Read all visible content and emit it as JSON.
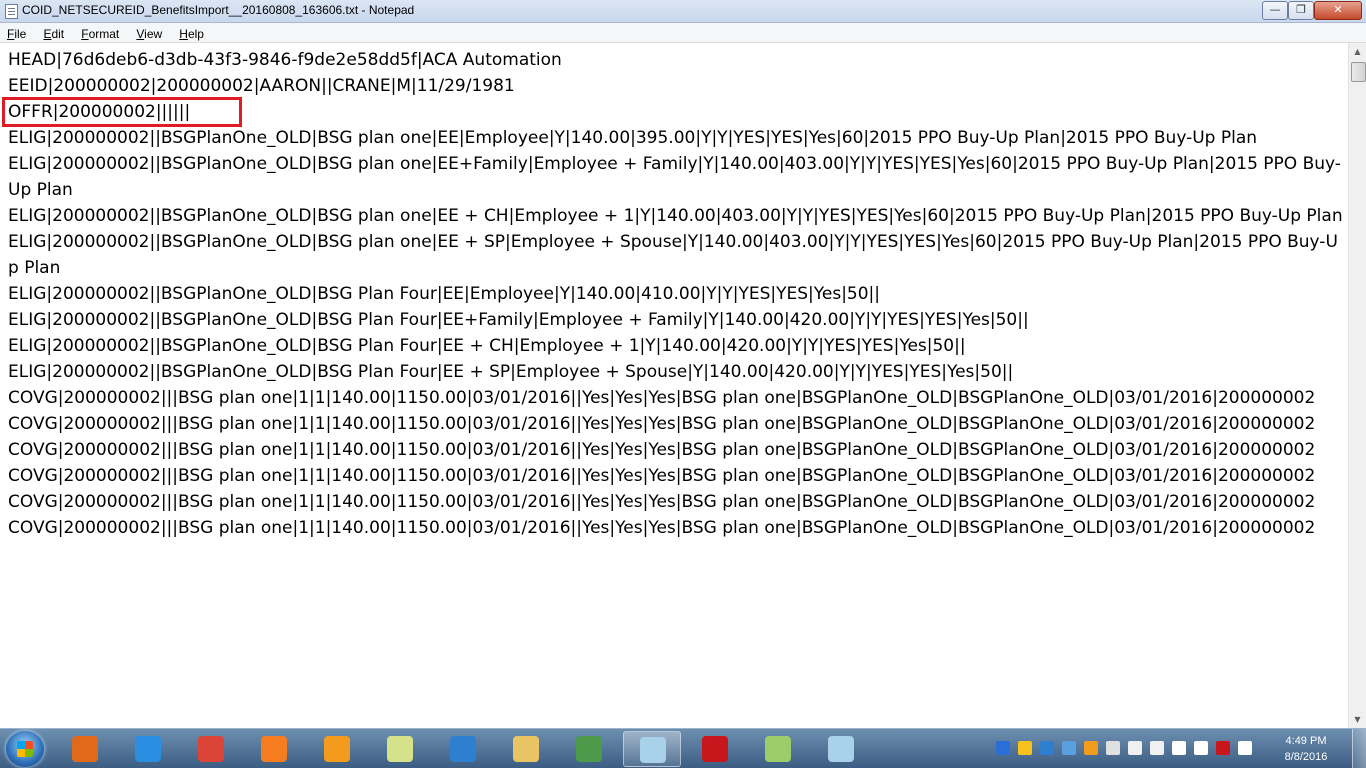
{
  "window": {
    "title": "COID_NETSECUREID_BenefitsImport__20160808_163606.txt - Notepad",
    "minimize_label": "—",
    "maximize_label": "❐",
    "close_label": "✕"
  },
  "menu": {
    "file": "File",
    "edit": "Edit",
    "format": "Format",
    "view": "View",
    "help": "Help"
  },
  "content": {
    "lines": [
      "HEAD|76d6deb6-d3db-43f3-9846-f9de2e58dd5f|ACA Automation",
      "EEID|200000002|200000002|AARON||CRANE|M|11/29/1981",
      "OFFR|200000002||||||",
      "ELIG|200000002||BSGPlanOne_OLD|BSG plan one|EE|Employee|Y|140.00|395.00|Y|Y|YES|YES|Yes|60|2015 PPO Buy-Up Plan|2015 PPO Buy-Up Plan",
      "ELIG|200000002||BSGPlanOne_OLD|BSG plan one|EE+Family|Employee + Family|Y|140.00|403.00|Y|Y|YES|YES|Yes|60|2015 PPO Buy-Up Plan|2015 PPO Buy-Up Plan",
      "ELIG|200000002||BSGPlanOne_OLD|BSG plan one|EE + CH|Employee + 1|Y|140.00|403.00|Y|Y|YES|YES|Yes|60|2015 PPO Buy-Up Plan|2015 PPO Buy-Up Plan",
      "ELIG|200000002||BSGPlanOne_OLD|BSG plan one|EE + SP|Employee + Spouse|Y|140.00|403.00|Y|Y|YES|YES|Yes|60|2015 PPO Buy-Up Plan|2015 PPO Buy-Up Plan",
      "ELIG|200000002||BSGPlanOne_OLD|BSG Plan Four|EE|Employee|Y|140.00|410.00|Y|Y|YES|YES|Yes|50||",
      "ELIG|200000002||BSGPlanOne_OLD|BSG Plan Four|EE+Family|Employee + Family|Y|140.00|420.00|Y|Y|YES|YES|Yes|50||",
      "ELIG|200000002||BSGPlanOne_OLD|BSG Plan Four|EE + CH|Employee + 1|Y|140.00|420.00|Y|Y|YES|YES|Yes|50||",
      "ELIG|200000002||BSGPlanOne_OLD|BSG Plan Four|EE + SP|Employee + Spouse|Y|140.00|420.00|Y|Y|YES|YES|Yes|50||",
      "COVG|200000002|||BSG plan one|1|1|140.00|1150.00|03/01/2016||Yes|Yes|Yes|BSG plan one|BSGPlanOne_OLD|BSGPlanOne_OLD|03/01/2016|200000002",
      "COVG|200000002|||BSG plan one|1|1|140.00|1150.00|03/01/2016||Yes|Yes|Yes|BSG plan one|BSGPlanOne_OLD|BSGPlanOne_OLD|03/01/2016|200000002",
      "COVG|200000002|||BSG plan one|1|1|140.00|1150.00|03/01/2016||Yes|Yes|Yes|BSG plan one|BSGPlanOne_OLD|BSGPlanOne_OLD|03/01/2016|200000002",
      "COVG|200000002|||BSG plan one|1|1|140.00|1150.00|03/01/2016||Yes|Yes|Yes|BSG plan one|BSGPlanOne_OLD|BSGPlanOne_OLD|03/01/2016|200000002",
      "COVG|200000002|||BSG plan one|1|1|140.00|1150.00|03/01/2016||Yes|Yes|Yes|BSG plan one|BSGPlanOne_OLD|BSGPlanOne_OLD|03/01/2016|200000002",
      "COVG|200000002|||BSG plan one|1|1|140.00|1150.00|03/01/2016||Yes|Yes|Yes|BSG plan one|BSGPlanOne_OLD|BSGPlanOne_OLD|03/01/2016|200000002"
    ],
    "highlight_color": "#e01b24"
  },
  "taskbar": {
    "apps": [
      {
        "name": "media-player-icon",
        "color": "#e06a1a",
        "active": false
      },
      {
        "name": "internet-explorer-icon",
        "color": "#2a8fe0",
        "active": false
      },
      {
        "name": "chrome-icon",
        "color": "#db4437",
        "active": false
      },
      {
        "name": "firefox-icon",
        "color": "#f57c1f",
        "active": false
      },
      {
        "name": "flame-app-icon",
        "color": "#f29b1d",
        "active": false
      },
      {
        "name": "sticky-notes-icon",
        "color": "#d6e28a",
        "active": false
      },
      {
        "name": "z-app-icon",
        "color": "#2f7fd1",
        "active": false
      },
      {
        "name": "file-explorer-icon",
        "color": "#e9c464",
        "active": false
      },
      {
        "name": "spreadsheet-icon",
        "color": "#4c9a4a",
        "active": false
      },
      {
        "name": "notepad-icon",
        "color": "#a9d2ea",
        "active": true
      },
      {
        "name": "pdf-reader-icon",
        "color": "#c8161d",
        "active": false
      },
      {
        "name": "notepad-plus-icon",
        "color": "#9ccd6a",
        "active": false
      },
      {
        "name": "notepad-icon-2",
        "color": "#a9d2ea",
        "active": false
      }
    ],
    "tray_icons": [
      "shield-tray-icon",
      "asterisk-tray-icon",
      "z-tray-icon",
      "sync-tray-icon",
      "flame-tray-icon",
      "network-monitor-tray-icon",
      "y-tray-icon",
      "pen-tray-icon",
      "flag-tray-icon",
      "display-tray-icon",
      "antivirus-tray-icon",
      "volume-tray-icon"
    ],
    "time": "4:49 PM",
    "date": "8/8/2016"
  }
}
